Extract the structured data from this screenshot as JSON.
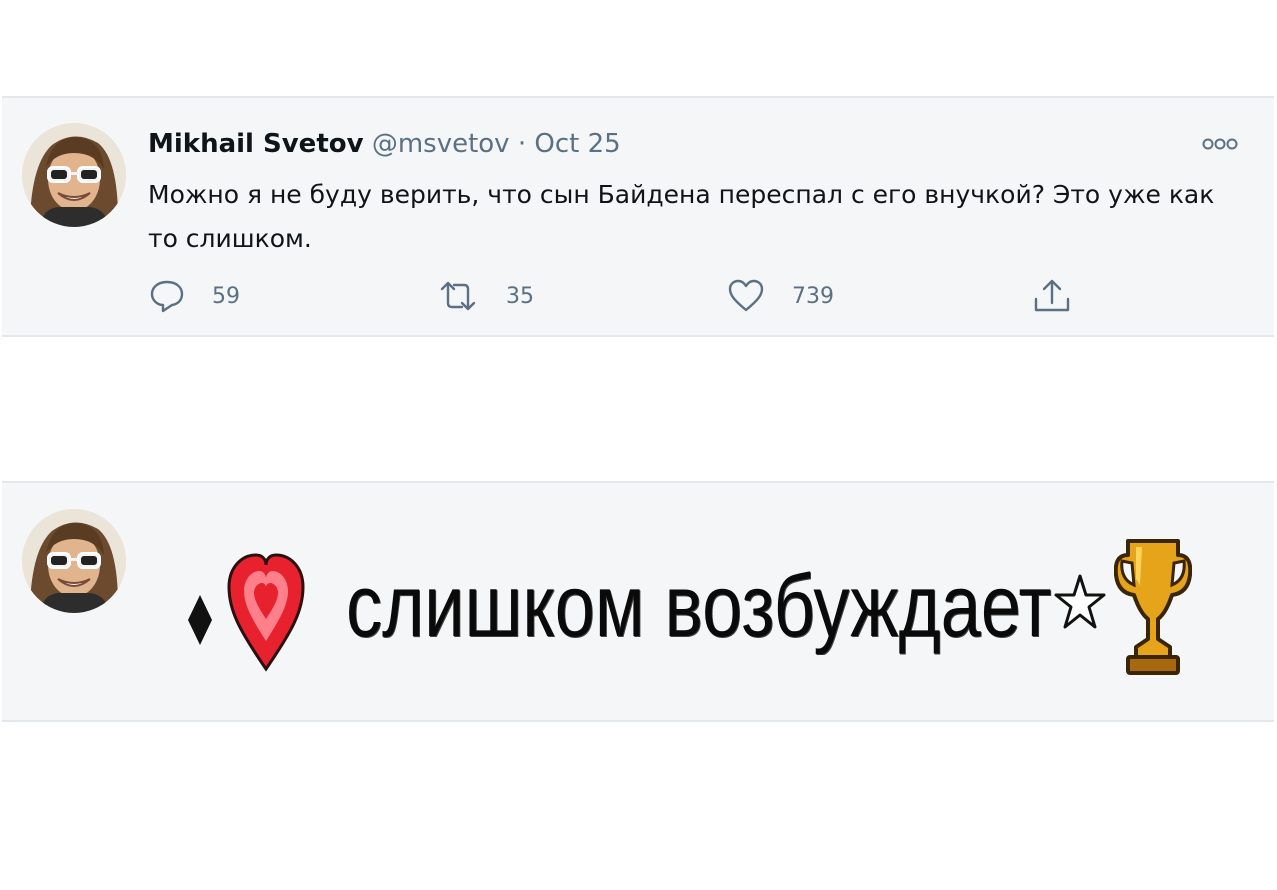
{
  "tweet": {
    "author_name": "Mikhail Svetov",
    "handle": "@msvetov",
    "separator": "·",
    "date": "Oct 25",
    "text": "Можно я не буду верить, что сын Байдена переспал с его внучкой? Это уже как то слишком.",
    "more_icon": "more-options-icon",
    "actions": {
      "reply": {
        "icon": "reply-icon",
        "count": "59"
      },
      "retweet": {
        "icon": "retweet-icon",
        "count": "35"
      },
      "like": {
        "icon": "heart-icon",
        "count": "739"
      },
      "share": {
        "icon": "share-icon"
      }
    }
  },
  "meme": {
    "caption": "слишком возбуждает",
    "icons": [
      "diamond-icon",
      "heart-icon",
      "star-icon",
      "trophy-icon"
    ]
  },
  "colors": {
    "card_bg": "#f5f6f7",
    "text_primary": "#0f1419",
    "text_secondary": "#5b7083",
    "heart_red": "#e8212e",
    "trophy_gold": "#e6a41a"
  }
}
